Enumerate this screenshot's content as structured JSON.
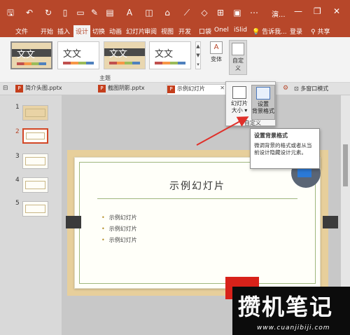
{
  "titlebar": {
    "doc_title": "演...",
    "minimize": "—",
    "restore": "❐",
    "close": "✕"
  },
  "menu": {
    "items": [
      "文件",
      "开始",
      "插入",
      "设计",
      "切换",
      "动画",
      "幻灯片",
      "审阅",
      "视图",
      "开发",
      "口袋",
      "Onel",
      "iSlid",
      "告诉我...",
      "登录",
      "共享"
    ],
    "active_index": 3
  },
  "ribbon": {
    "themes": [
      {
        "label": "文文",
        "style": "wood"
      },
      {
        "label": "文文",
        "style": "plain"
      },
      {
        "label": "文文",
        "style": "wood"
      },
      {
        "label": "文文",
        "style": "plain"
      }
    ],
    "group_theme_label": "主题",
    "variants_label": "变体",
    "custom_label_line1": "自定",
    "custom_label_line2": "义"
  },
  "tabs": [
    {
      "label": "简介头图.pptx",
      "active": false
    },
    {
      "label": "截图阴影.pptx",
      "active": false
    },
    {
      "label": "示例幻灯片",
      "active": true
    }
  ],
  "tabs_close": "✕",
  "tabs_right": {
    "windows_label": "多窗口模式"
  },
  "dropdown": {
    "slide_size_line1": "幻灯片",
    "slide_size_line2": "大小",
    "format_bg_line1": "设置",
    "format_bg_line2": "背景格式",
    "group_label": "自定义"
  },
  "tooltip": {
    "title": "设置背景格式",
    "body": "微调背景的格式或者从当前设计隐藏设计元素。"
  },
  "thumbnails": [
    {
      "number": "1",
      "selected": false
    },
    {
      "number": "2",
      "selected": true
    },
    {
      "number": "3",
      "selected": false
    },
    {
      "number": "4",
      "selected": false
    },
    {
      "number": "5",
      "selected": false
    }
  ],
  "slide": {
    "title": "示例幻灯片",
    "bullets": [
      "示例幻灯片",
      "示例幻灯片",
      "示例幻灯片"
    ]
  },
  "watermark": {
    "text": "攒机笔记",
    "url": "www.cuanjibiji.com"
  },
  "colors": {
    "accent": "#b7472a",
    "arrow": "#e0302a"
  }
}
